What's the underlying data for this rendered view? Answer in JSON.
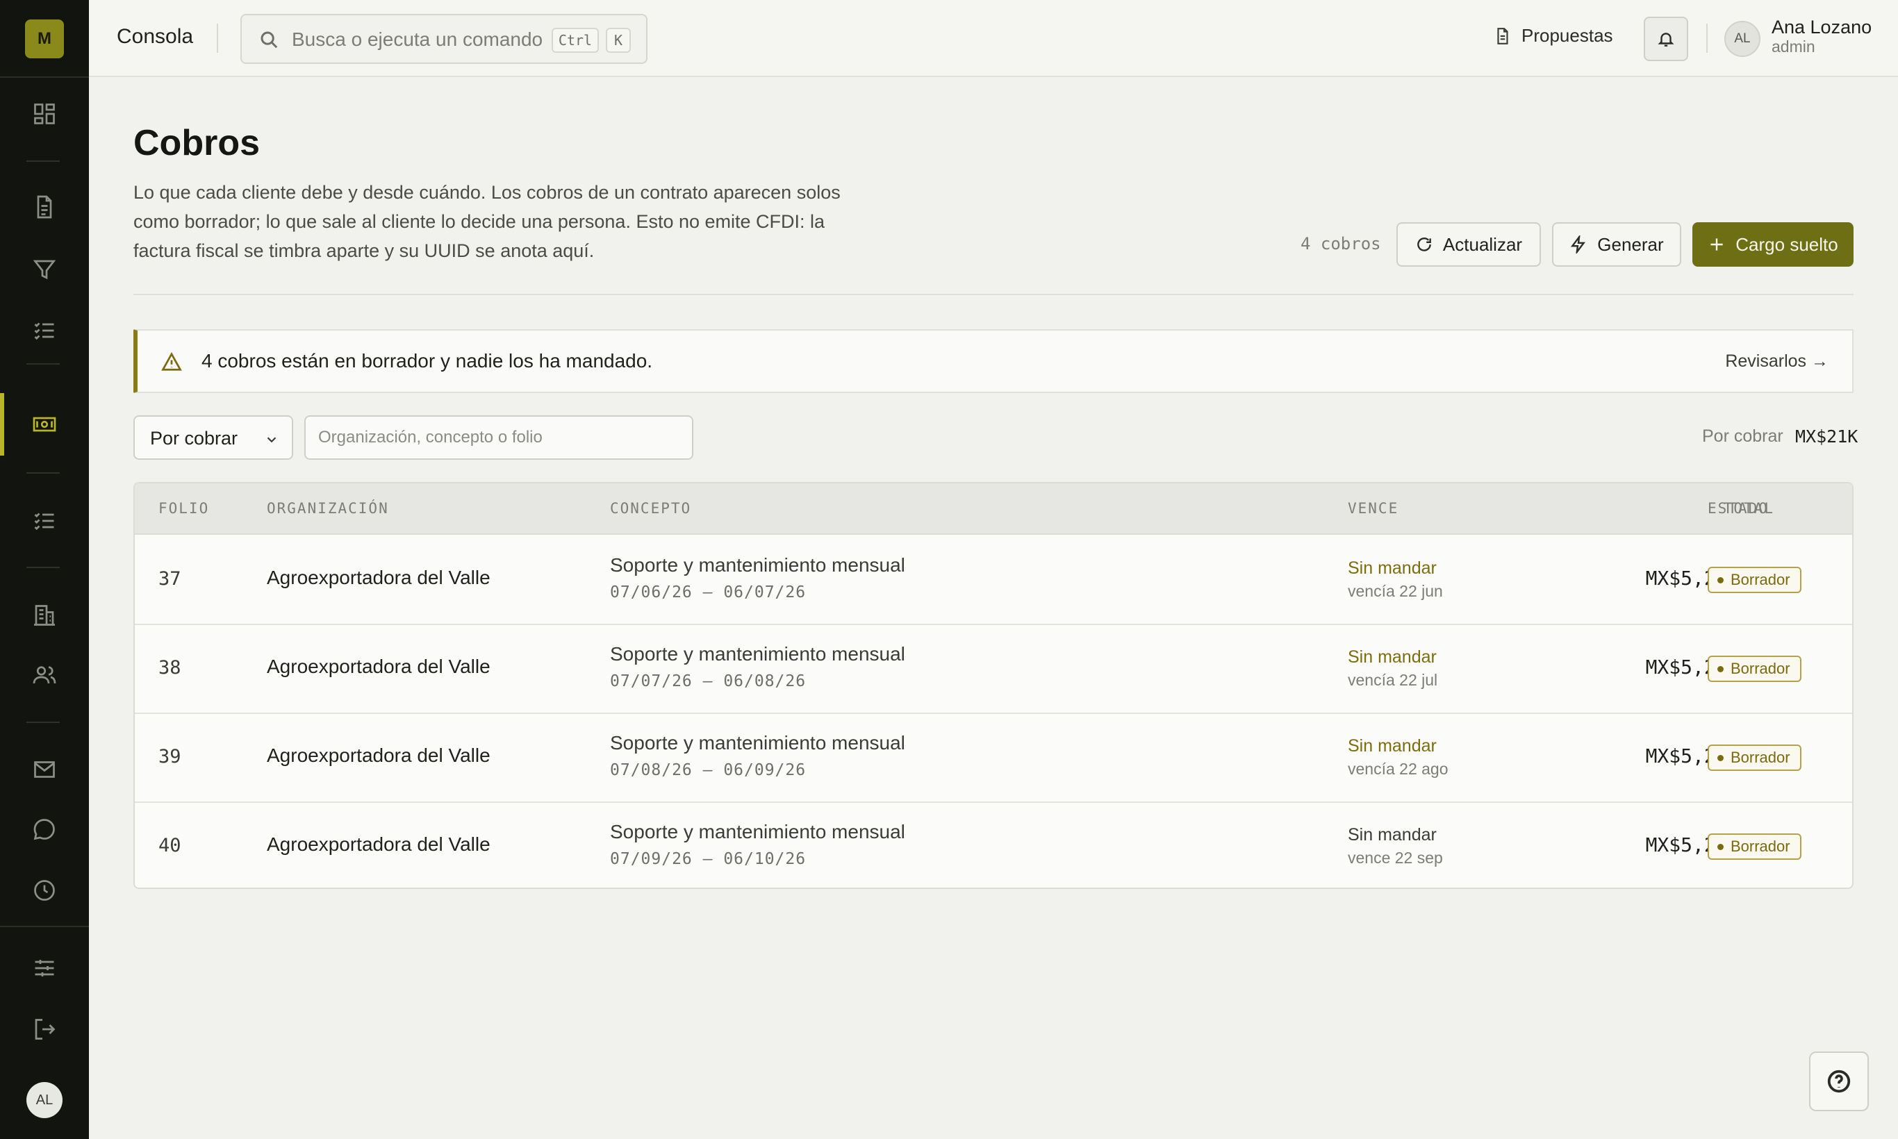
{
  "sidebar": {
    "logo": "M",
    "icons": [
      "dashboard-icon",
      "document-icon",
      "filter-icon",
      "checklist-icon",
      "billing-icon",
      "tasks-icon",
      "building-icon",
      "users-icon",
      "mail-icon",
      "chat-icon",
      "clock-icon",
      "settings-icon",
      "logout-icon"
    ],
    "active": "billing-icon",
    "avatar_initials": "AL"
  },
  "topbar": {
    "title": "Consola",
    "search": {
      "placeholder": "Busca o ejecuta un comando",
      "kbd_1": "Ctrl",
      "kbd_2": "K"
    },
    "proposals_link": "Propuestas",
    "user": {
      "initials": "AL",
      "name": "Ana Lozano",
      "role": "admin"
    }
  },
  "page": {
    "title": "Cobros",
    "description": "Lo que cada cliente debe y desde cuándo. Los cobros de un contrato aparecen solos como borrador; lo que sale al cliente lo decide una persona. Esto no emite CFDI: la factura fiscal se timbra aparte y su UUID se anota aquí.",
    "count_label": "4 cobros",
    "buttons": {
      "refresh": "Actualizar",
      "generate": "Generar",
      "add_charge": "Cargo suelto"
    }
  },
  "alert": {
    "text": "4 cobros están en borrador y nadie los ha mandado.",
    "link": "Revisarlos →"
  },
  "filters": {
    "status_selected": "Por cobrar",
    "search_placeholder": "Organización, concepto o folio",
    "summary_label": "Por cobrar",
    "summary_value": "MX$21K"
  },
  "table": {
    "columns": {
      "folio": "FOLIO",
      "org": "ORGANIZACIÓN",
      "concept": "CONCEPTO",
      "due": "VENCE",
      "total": "TOTAL",
      "status": "ESTADO"
    },
    "rows": [
      {
        "folio": "37",
        "org": "Agroexportadora del Valle",
        "concept": "Soporte y mantenimiento mensual",
        "period": "07/06/26 – 06/07/26",
        "due": "Sin mandar",
        "due_sub": "vencía 22 jun",
        "total": "MX$5,220.00",
        "status": "Borrador"
      },
      {
        "folio": "38",
        "org": "Agroexportadora del Valle",
        "concept": "Soporte y mantenimiento mensual",
        "period": "07/07/26 – 06/08/26",
        "due": "Sin mandar",
        "due_sub": "vencía 22 jul",
        "total": "MX$5,220.00",
        "status": "Borrador"
      },
      {
        "folio": "39",
        "org": "Agroexportadora del Valle",
        "concept": "Soporte y mantenimiento mensual",
        "period": "07/08/26 – 06/09/26",
        "due": "Sin mandar",
        "due_sub": "vencía 22 ago",
        "total": "MX$5,220.00",
        "status": "Borrador"
      },
      {
        "folio": "40",
        "org": "Agroexportadora del Valle",
        "concept": "Soporte y mantenimiento mensual",
        "period": "07/09/26 – 06/10/26",
        "due": "Sin mandar",
        "due_sub": "vence 22 sep",
        "total": "MX$5,220.00",
        "status": "Borrador"
      }
    ]
  },
  "colors": {
    "accent": "#6e6e14",
    "warning": "#7d6d0c",
    "sidebar_bg": "#121410"
  }
}
